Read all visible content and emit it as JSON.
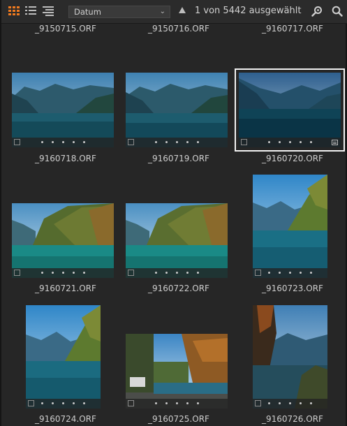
{
  "toolbar": {
    "sort_value": "Datum",
    "selection_status": "1 von 5442 ausgewählt",
    "icons": [
      "grid-view-icon",
      "list-view-icon",
      "detail-view-icon",
      "sort-ascending-icon",
      "loupe-icon",
      "search-icon"
    ],
    "accent_color": "#f07a1f"
  },
  "top_labels": [
    "_9150715.ORF",
    "_9150716.ORF",
    "_9160717.ORF"
  ],
  "items": [
    {
      "name": "_9160718.ORF",
      "selected": false,
      "badge": false
    },
    {
      "name": "_9160719.ORF",
      "selected": false,
      "badge": false
    },
    {
      "name": "_9160720.ORF",
      "selected": true,
      "badge": true
    },
    {
      "name": "_9160721.ORF",
      "selected": false,
      "badge": false
    },
    {
      "name": "_9160722.ORF",
      "selected": false,
      "badge": false
    },
    {
      "name": "_9160723.ORF",
      "selected": false,
      "badge": false
    },
    {
      "name": "_9160724.ORF",
      "selected": false,
      "badge": false
    },
    {
      "name": "_9160725.ORF",
      "selected": false,
      "badge": false
    },
    {
      "name": "_9160726.ORF",
      "selected": false,
      "badge": false
    }
  ]
}
